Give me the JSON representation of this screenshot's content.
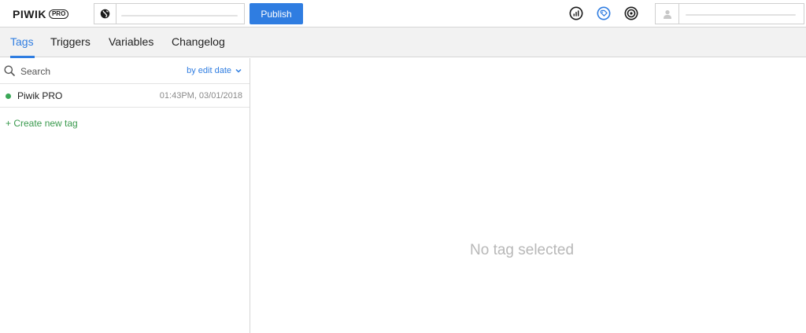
{
  "header": {
    "logo_text": "PIWIK",
    "logo_badge": "PRO",
    "site_value": "",
    "publish_label": "Publish",
    "icons": [
      "analytics-icon",
      "tag-icon",
      "target-icon"
    ],
    "user_name": ""
  },
  "tabs": [
    {
      "label": "Tags",
      "active": true
    },
    {
      "label": "Triggers",
      "active": false
    },
    {
      "label": "Variables",
      "active": false
    },
    {
      "label": "Changelog",
      "active": false
    }
  ],
  "sidebar": {
    "search_placeholder": "Search",
    "sort_label": "by edit date",
    "tags": [
      {
        "name": "Piwik PRO",
        "edited": "01:43PM, 03/01/2018",
        "status": "active"
      }
    ],
    "create_label": "+ Create new tag"
  },
  "main": {
    "empty_text": "No tag selected"
  },
  "colors": {
    "accent": "#2f7de1",
    "status_active": "#3aa757",
    "create_link": "#3a9a4e"
  }
}
